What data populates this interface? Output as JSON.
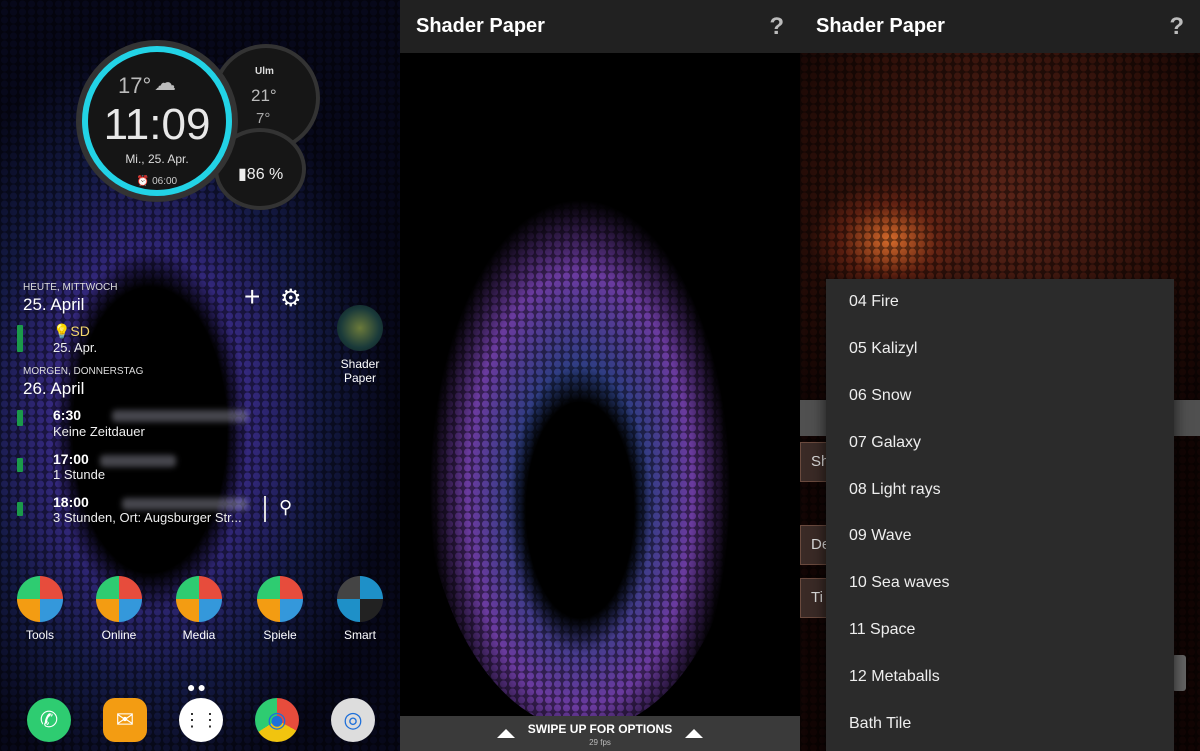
{
  "home": {
    "clock": {
      "temp": "17°",
      "time": "11:09",
      "date": "Mi., 25. Apr.",
      "alarm": "⏰ 06:00"
    },
    "weather": {
      "city": "Ulm",
      "high": "21°",
      "low": "7°"
    },
    "battery": "▮86 %",
    "calendar": {
      "today_head": "HEUTE, MITTWOCH",
      "today_date": "25. April",
      "tomorrow_head": "MORGEN, DONNERSTAG",
      "tomorrow_date": "26. April",
      "events": [
        {
          "title": "💡SD",
          "sub": "25. Apr."
        },
        {
          "title": "6:30",
          "sub": "Keine Zeitdauer"
        },
        {
          "title": "17:00",
          "sub": "1 Stunde"
        },
        {
          "title": "18:00",
          "sub": "3 Stunden, Ort: Augsburger Str..."
        }
      ]
    },
    "shortcut_label": "Shader Paper",
    "folders": [
      {
        "label": "Tools"
      },
      {
        "label": "Online"
      },
      {
        "label": "Media"
      },
      {
        "label": "Spiele"
      },
      {
        "label": "Smart"
      }
    ],
    "dock": [
      {
        "icon": "phone-icon",
        "glyph": "✆"
      },
      {
        "icon": "messages-icon",
        "glyph": "✉"
      },
      {
        "icon": "app-drawer-icon",
        "glyph": "⋮⋮"
      },
      {
        "icon": "chrome-icon",
        "glyph": "◉"
      },
      {
        "icon": "camera-folder-icon",
        "glyph": "◎"
      }
    ]
  },
  "preview": {
    "title": "Shader Paper",
    "help": "?",
    "swipe": "SWIPE UP FOR OPTIONS",
    "fps": "29 fps"
  },
  "options": {
    "title": "Shader Paper",
    "help": "?",
    "behind_labels": [
      "Sh",
      "De",
      "Ti"
    ],
    "menu": [
      "04 Fire",
      "05 Kalizyl",
      "06 Snow",
      "07 Galaxy",
      "08 Light rays",
      "09 Wave",
      "10 Sea waves",
      "11 Space",
      "12 Metaballs",
      "Bath Tile"
    ]
  }
}
